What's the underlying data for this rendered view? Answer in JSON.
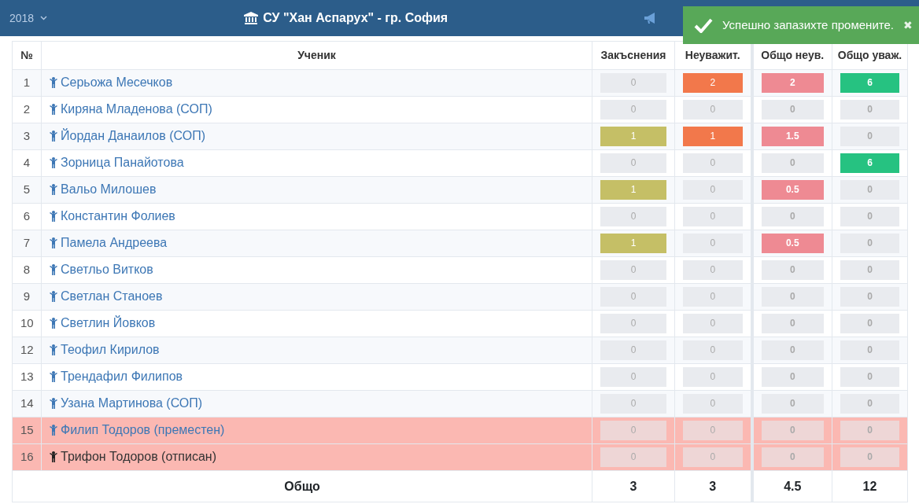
{
  "navbar": {
    "year": "2018",
    "title": "СУ \"Хан Аспарух\" - гр. София"
  },
  "toast": {
    "message": "Успешно запазихте промените.",
    "close": "✖"
  },
  "table": {
    "columns": [
      "№",
      "Ученик",
      "Закъснения",
      "Неуважит.",
      "Общо неув.",
      "Общо уваж."
    ],
    "rows": [
      {
        "kind": "active",
        "cells": [
          {
            "value": "1"
          },
          {
            "value": "Серьожа Месечков"
          },
          {
            "value": "0",
            "color": "#e9ebef"
          },
          {
            "value": "2",
            "color": "#f2784b"
          },
          {
            "value": "2",
            "color": "#ee8a93"
          },
          {
            "value": "6",
            "color": "#26c281"
          }
        ]
      },
      {
        "kind": "active",
        "cells": [
          {
            "value": "2"
          },
          {
            "value": "Киряна Младенова (СОП)"
          },
          {
            "value": "0",
            "color": "#e9ebef"
          },
          {
            "value": "0",
            "color": "#e9ebef"
          },
          {
            "value": "0",
            "color": "#e9ebef"
          },
          {
            "value": "0",
            "color": "#e9ebef"
          }
        ]
      },
      {
        "kind": "active",
        "cells": [
          {
            "value": "3"
          },
          {
            "value": "Йордан Данаилов (СОП)"
          },
          {
            "value": "1",
            "color": "#c5bf66"
          },
          {
            "value": "1",
            "color": "#f2784b"
          },
          {
            "value": "1.5",
            "color": "#ee8a93"
          },
          {
            "value": "0",
            "color": "#e9ebef"
          }
        ]
      },
      {
        "kind": "active",
        "cells": [
          {
            "value": "4"
          },
          {
            "value": "Зорница Панайотова"
          },
          {
            "value": "0",
            "color": "#e9ebef"
          },
          {
            "value": "0",
            "color": "#e9ebef"
          },
          {
            "value": "0",
            "color": "#e9ebef"
          },
          {
            "value": "6",
            "color": "#26c281"
          }
        ]
      },
      {
        "kind": "active",
        "cells": [
          {
            "value": "5"
          },
          {
            "value": "Вальо Милошев"
          },
          {
            "value": "1",
            "color": "#c5bf66"
          },
          {
            "value": "0",
            "color": "#e9ebef"
          },
          {
            "value": "0.5",
            "color": "#ee8a93"
          },
          {
            "value": "0",
            "color": "#e9ebef"
          }
        ]
      },
      {
        "kind": "active",
        "cells": [
          {
            "value": "6"
          },
          {
            "value": "Константин Фолиев"
          },
          {
            "value": "0",
            "color": "#e9ebef"
          },
          {
            "value": "0",
            "color": "#e9ebef"
          },
          {
            "value": "0",
            "color": "#e9ebef"
          },
          {
            "value": "0",
            "color": "#e9ebef"
          }
        ]
      },
      {
        "kind": "active",
        "cells": [
          {
            "value": "7"
          },
          {
            "value": "Памела Андреева"
          },
          {
            "value": "1",
            "color": "#c5bf66"
          },
          {
            "value": "0",
            "color": "#e9ebef"
          },
          {
            "value": "0.5",
            "color": "#ee8a93"
          },
          {
            "value": "0",
            "color": "#e9ebef"
          }
        ]
      },
      {
        "kind": "active",
        "cells": [
          {
            "value": "8"
          },
          {
            "value": "Светльо Витков"
          },
          {
            "value": "0",
            "color": "#e9ebef"
          },
          {
            "value": "0",
            "color": "#e9ebef"
          },
          {
            "value": "0",
            "color": "#e9ebef"
          },
          {
            "value": "0",
            "color": "#e9ebef"
          }
        ]
      },
      {
        "kind": "active",
        "cells": [
          {
            "value": "9"
          },
          {
            "value": "Светлан Станоев"
          },
          {
            "value": "0",
            "color": "#e9ebef"
          },
          {
            "value": "0",
            "color": "#e9ebef"
          },
          {
            "value": "0",
            "color": "#e9ebef"
          },
          {
            "value": "0",
            "color": "#e9ebef"
          }
        ]
      },
      {
        "kind": "active",
        "cells": [
          {
            "value": "10"
          },
          {
            "value": "Светлин Йовков"
          },
          {
            "value": "0",
            "color": "#e9ebef"
          },
          {
            "value": "0",
            "color": "#e9ebef"
          },
          {
            "value": "0",
            "color": "#e9ebef"
          },
          {
            "value": "0",
            "color": "#e9ebef"
          }
        ]
      },
      {
        "kind": "active",
        "cells": [
          {
            "value": "12"
          },
          {
            "value": "Теофил Кирилов"
          },
          {
            "value": "0",
            "color": "#e9ebef"
          },
          {
            "value": "0",
            "color": "#e9ebef"
          },
          {
            "value": "0",
            "color": "#e9ebef"
          },
          {
            "value": "0",
            "color": "#e9ebef"
          }
        ]
      },
      {
        "kind": "active",
        "cells": [
          {
            "value": "13"
          },
          {
            "value": "Трендафил Филипов"
          },
          {
            "value": "0",
            "color": "#e9ebef"
          },
          {
            "value": "0",
            "color": "#e9ebef"
          },
          {
            "value": "0",
            "color": "#e9ebef"
          },
          {
            "value": "0",
            "color": "#e9ebef"
          }
        ]
      },
      {
        "kind": "active",
        "cells": [
          {
            "value": "14"
          },
          {
            "value": "Узана Мартинова (СОП)"
          },
          {
            "value": "0",
            "color": "#e9ebef"
          },
          {
            "value": "0",
            "color": "#e9ebef"
          },
          {
            "value": "0",
            "color": "#e9ebef"
          },
          {
            "value": "0",
            "color": "#e9ebef"
          }
        ]
      },
      {
        "kind": "transferred",
        "cells": [
          {
            "value": "15"
          },
          {
            "value": "Филип Тодоров (преместен)"
          },
          {
            "value": "0",
            "color": "#eed6d6"
          },
          {
            "value": "0",
            "color": "#eed6d6"
          },
          {
            "value": "0",
            "color": "#eed6d6"
          },
          {
            "value": "0",
            "color": "#eed6d6"
          }
        ]
      },
      {
        "kind": "unenrolled",
        "cells": [
          {
            "value": "16"
          },
          {
            "value": "Трифон Тодоров (отписан)"
          },
          {
            "value": "0",
            "color": "#eed6d6"
          },
          {
            "value": "0",
            "color": "#eed6d6"
          },
          {
            "value": "0",
            "color": "#eed6d6"
          },
          {
            "value": "0",
            "color": "#eed6d6"
          }
        ]
      }
    ],
    "footer": {
      "label": "Общо",
      "totals": [
        "3",
        "3",
        "4.5",
        "12"
      ]
    }
  }
}
